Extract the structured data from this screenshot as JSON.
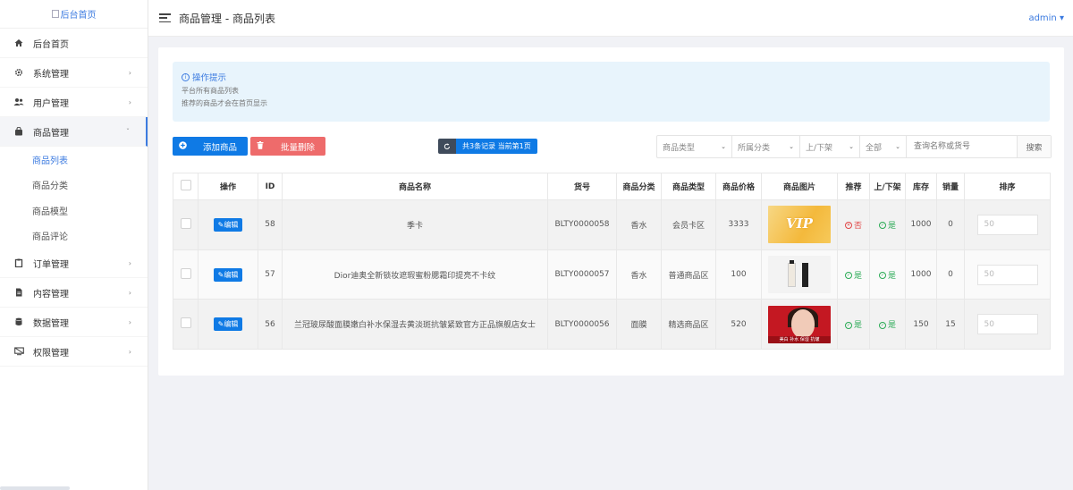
{
  "sidebar": {
    "logo_alt": "后台首页",
    "items": [
      {
        "label": "后台首页",
        "icon": "home-icon"
      },
      {
        "label": "系统管理",
        "icon": "gear-icon"
      },
      {
        "label": "用户管理",
        "icon": "users-icon"
      },
      {
        "label": "商品管理",
        "icon": "bag-icon"
      },
      {
        "label": "订单管理",
        "icon": "clipboard-icon"
      },
      {
        "label": "内容管理",
        "icon": "file-icon"
      },
      {
        "label": "数据管理",
        "icon": "database-icon"
      },
      {
        "label": "权限管理",
        "icon": "monitor-icon"
      }
    ],
    "sub_items": [
      "商品列表",
      "商品分类",
      "商品模型",
      "商品评论"
    ]
  },
  "header": {
    "title": "商品管理 - 商品列表",
    "user": "admin"
  },
  "tip": {
    "title": "操作提示",
    "lines": [
      "平台所有商品列表",
      "推荐的商品才会在首页显示"
    ]
  },
  "toolbar": {
    "add_label": "添加商品",
    "delete_label": "批量删除",
    "record_text": "共3条记录 当前第1页",
    "filters": [
      "商品类型",
      "所属分类",
      "上/下架",
      "全部"
    ],
    "search_placeholder": "查询名称或货号",
    "search_label": "搜索"
  },
  "table": {
    "headers": [
      "操作",
      "ID",
      "商品名称",
      "货号",
      "商品分类",
      "商品类型",
      "商品价格",
      "商品图片",
      "推荐",
      "上/下架",
      "库存",
      "销量",
      "排序"
    ],
    "edit_label": "编辑",
    "rows": [
      {
        "id": "58",
        "name": "季卡",
        "sku": "BLTY0000058",
        "category": "香水",
        "type": "会员卡区",
        "price": "3333",
        "image": "vip-card",
        "image_text": "VIP",
        "recommend": "否",
        "on_shelf": "是",
        "stock": "1000",
        "sales": "0",
        "sort": "50"
      },
      {
        "id": "57",
        "name": "Dior迪奥全新锁妆遮瑕蜜粉腮霜印提亮不卡纹",
        "sku": "BLTY0000057",
        "category": "香水",
        "type": "普通商品区",
        "price": "100",
        "image": "dior-product",
        "image_text": "",
        "recommend": "是",
        "on_shelf": "是",
        "stock": "1000",
        "sales": "0",
        "sort": "50"
      },
      {
        "id": "56",
        "name": "兰冠玻尿酸面膜嫩白补水保湿去黄淡斑抗皱紧致官方正品旗舰店女士",
        "sku": "BLTY0000056",
        "category": "面膜",
        "type": "精选商品区",
        "price": "520",
        "image": "mask-model",
        "image_text": "美白 补水 保湿 抗皱",
        "recommend": "是",
        "on_shelf": "是",
        "stock": "150",
        "sales": "15",
        "sort": "50"
      }
    ]
  },
  "colors": {
    "accent": "#0f7ae5",
    "danger": "#ee6b6b",
    "success": "#2bab56",
    "tip_bg": "#e8f4fc"
  }
}
